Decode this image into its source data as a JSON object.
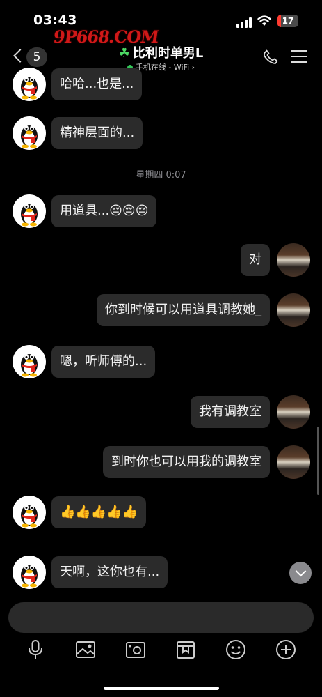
{
  "status_bar": {
    "time": "03:43",
    "battery": "17",
    "battery_level": 0.17
  },
  "watermark": "9P668.COM",
  "header": {
    "back_count": "5",
    "title": "比利时单男L",
    "subtitle": "手机在线 - WiFi",
    "subtitle_chevron": "›"
  },
  "chat": {
    "timestamp": "星期四 0:07",
    "messages": [
      {
        "side": "left",
        "text": "哈哈...也是..."
      },
      {
        "side": "left",
        "text": "精神层面的..."
      },
      {
        "side": "left",
        "text": "用道具...😔😔😔"
      },
      {
        "side": "right",
        "text": "对"
      },
      {
        "side": "right",
        "text": "你到时候可以用道具调教她_"
      },
      {
        "side": "left",
        "text": "嗯，听师傅的..."
      },
      {
        "side": "right",
        "text": "我有调教室"
      },
      {
        "side": "right",
        "text": "到时你也可以用我的调教室"
      },
      {
        "side": "left",
        "text": "👍👍👍👍👍"
      },
      {
        "side": "left",
        "text": "天啊，这你也有..."
      }
    ]
  },
  "input": {
    "placeholder": ""
  },
  "toolbar": [
    "microphone-icon",
    "image-icon",
    "camera-icon",
    "gift-icon",
    "emoji-icon",
    "plus-icon"
  ]
}
